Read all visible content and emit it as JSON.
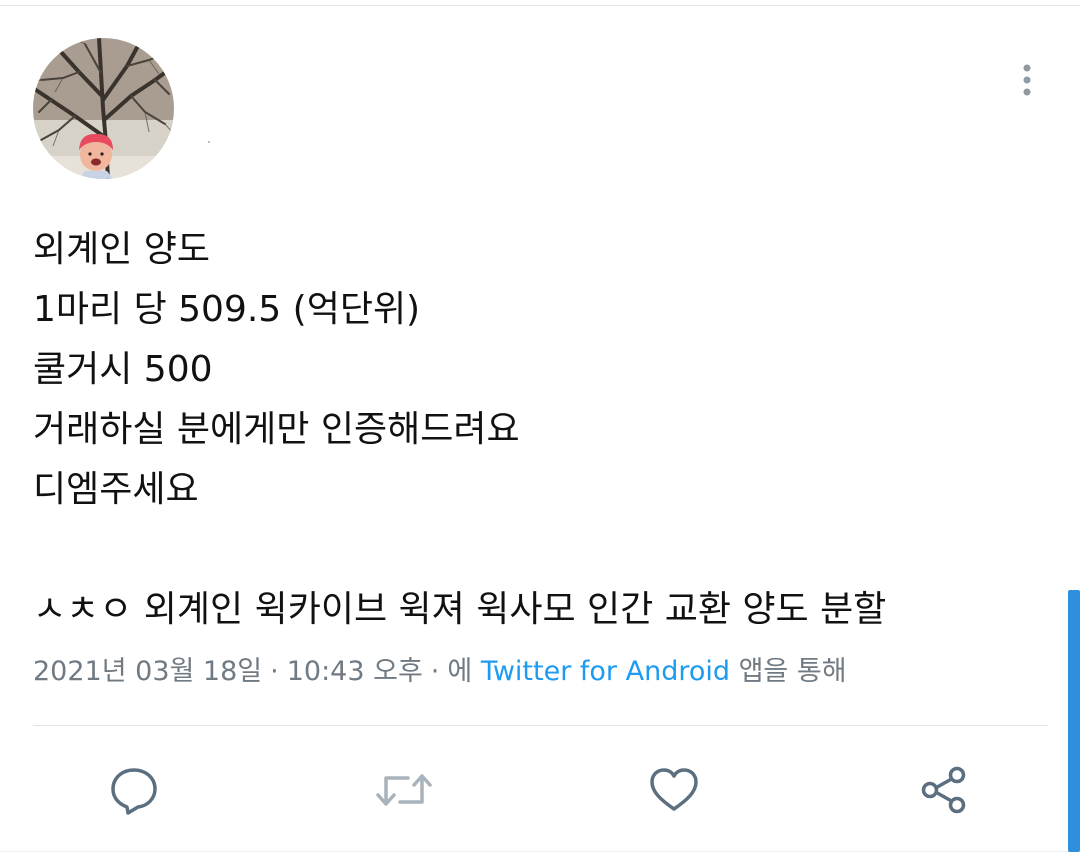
{
  "tweet": {
    "lines": [
      "외계인 양도",
      "1마리 당 509.5 (억단위)",
      "쿨거시 500",
      "거래하실 분에게만 인증해드려요",
      "디엠주세요",
      "",
      "ㅅㅊㅇ 외계인 윅카이브 윅져 윅사모 인간 교환 양도 분할"
    ]
  },
  "meta": {
    "date": "2021년 03월 18일",
    "separator": "·",
    "time": "10:43 오후",
    "source_prefix": "에",
    "source": "Twitter for Android",
    "source_suffix": "앱을 통해"
  },
  "actions": {
    "reply_icon": "reply-icon",
    "retweet_icon": "retweet-icon",
    "like_icon": "like-icon",
    "share_icon": "share-icon"
  },
  "colors": {
    "text": "#111111",
    "meta": "#707a83",
    "link": "#1d9bf0",
    "icon": "#5b6f80",
    "divider": "#dde3e8",
    "scrollbar": "#2f8fdc"
  }
}
